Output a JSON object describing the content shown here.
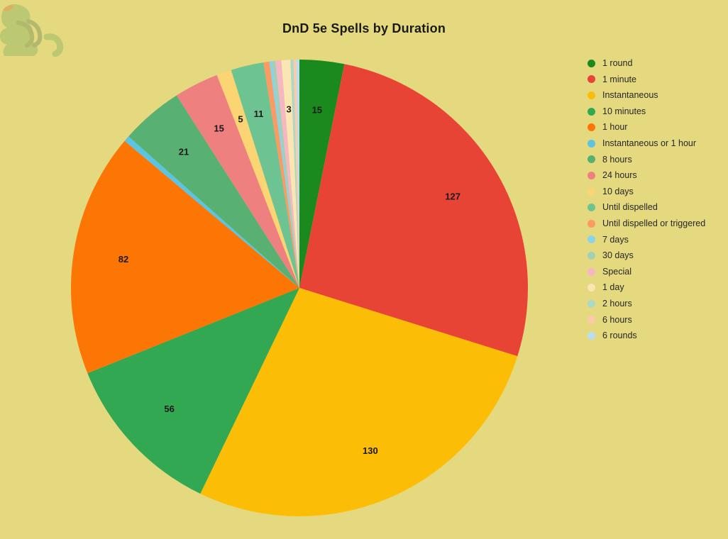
{
  "chart_title": "DnD 5e Spells by Duration",
  "background_color": "#e5d97f",
  "watermark": {
    "name": "dragon-logo",
    "color": "#9dbb6a"
  },
  "chart_data": {
    "type": "pie",
    "title": "DnD 5e Spells by Duration",
    "xlabel": "",
    "ylabel": "",
    "legend_position": "right",
    "grid": false,
    "start_angle_deg": 0,
    "direction": "clockwise",
    "categories": [
      "1 round",
      "1 minute",
      "Instantaneous",
      "10 minutes",
      "1 hour",
      "Instantaneous or 1 hour",
      "8 hours",
      "24 hours",
      "10 days",
      "Until dispelled",
      "Until dispelled or triggered",
      "7 days",
      "30 days",
      "Special",
      "1 day",
      "2 hours",
      "6 hours",
      "6 rounds"
    ],
    "values": [
      15,
      127,
      130,
      56,
      82,
      2,
      21,
      15,
      5,
      11,
      2,
      1,
      1,
      2,
      3,
      1,
      1,
      1
    ],
    "colors": [
      "#1b8a1e",
      "#e84436",
      "#fbbd06",
      "#33a852",
      "#fb7605",
      "#5bc4e0",
      "#58b072",
      "#ee8080",
      "#fbd473",
      "#6dc392",
      "#fb9a63",
      "#8ad3e6",
      "#a5cfb4",
      "#f6b6c2",
      "#f9e6b2",
      "#abd9c6",
      "#fbc9ac",
      "#b9dfef"
    ],
    "shown_labels": [
      "15",
      "127",
      "130",
      "56",
      "82",
      "",
      "21",
      "15",
      "5",
      "11",
      "",
      "",
      "",
      "",
      "3",
      "",
      "",
      ""
    ],
    "total": 474
  },
  "legend": {
    "items": [
      {
        "label": "1 round",
        "color": "#1b8a1e"
      },
      {
        "label": "1 minute",
        "color": "#e84436"
      },
      {
        "label": "Instantaneous",
        "color": "#fbbd06"
      },
      {
        "label": "10 minutes",
        "color": "#33a852"
      },
      {
        "label": "1 hour",
        "color": "#fb7605"
      },
      {
        "label": "Instantaneous or 1 hour",
        "color": "#5bc4e0"
      },
      {
        "label": "8 hours",
        "color": "#58b072"
      },
      {
        "label": "24 hours",
        "color": "#ee8080"
      },
      {
        "label": "10 days",
        "color": "#fbd473"
      },
      {
        "label": "Until dispelled",
        "color": "#6dc392"
      },
      {
        "label": "Until dispelled or triggered",
        "color": "#fb9a63"
      },
      {
        "label": "7 days",
        "color": "#8ad3e6"
      },
      {
        "label": "30 days",
        "color": "#a5cfb4"
      },
      {
        "label": "Special",
        "color": "#f6b6c2"
      },
      {
        "label": "1 day",
        "color": "#f9e6b2"
      },
      {
        "label": "2 hours",
        "color": "#abd9c6"
      },
      {
        "label": "6 hours",
        "color": "#fbc9ac"
      },
      {
        "label": "6 rounds",
        "color": "#b9dfef"
      }
    ]
  }
}
